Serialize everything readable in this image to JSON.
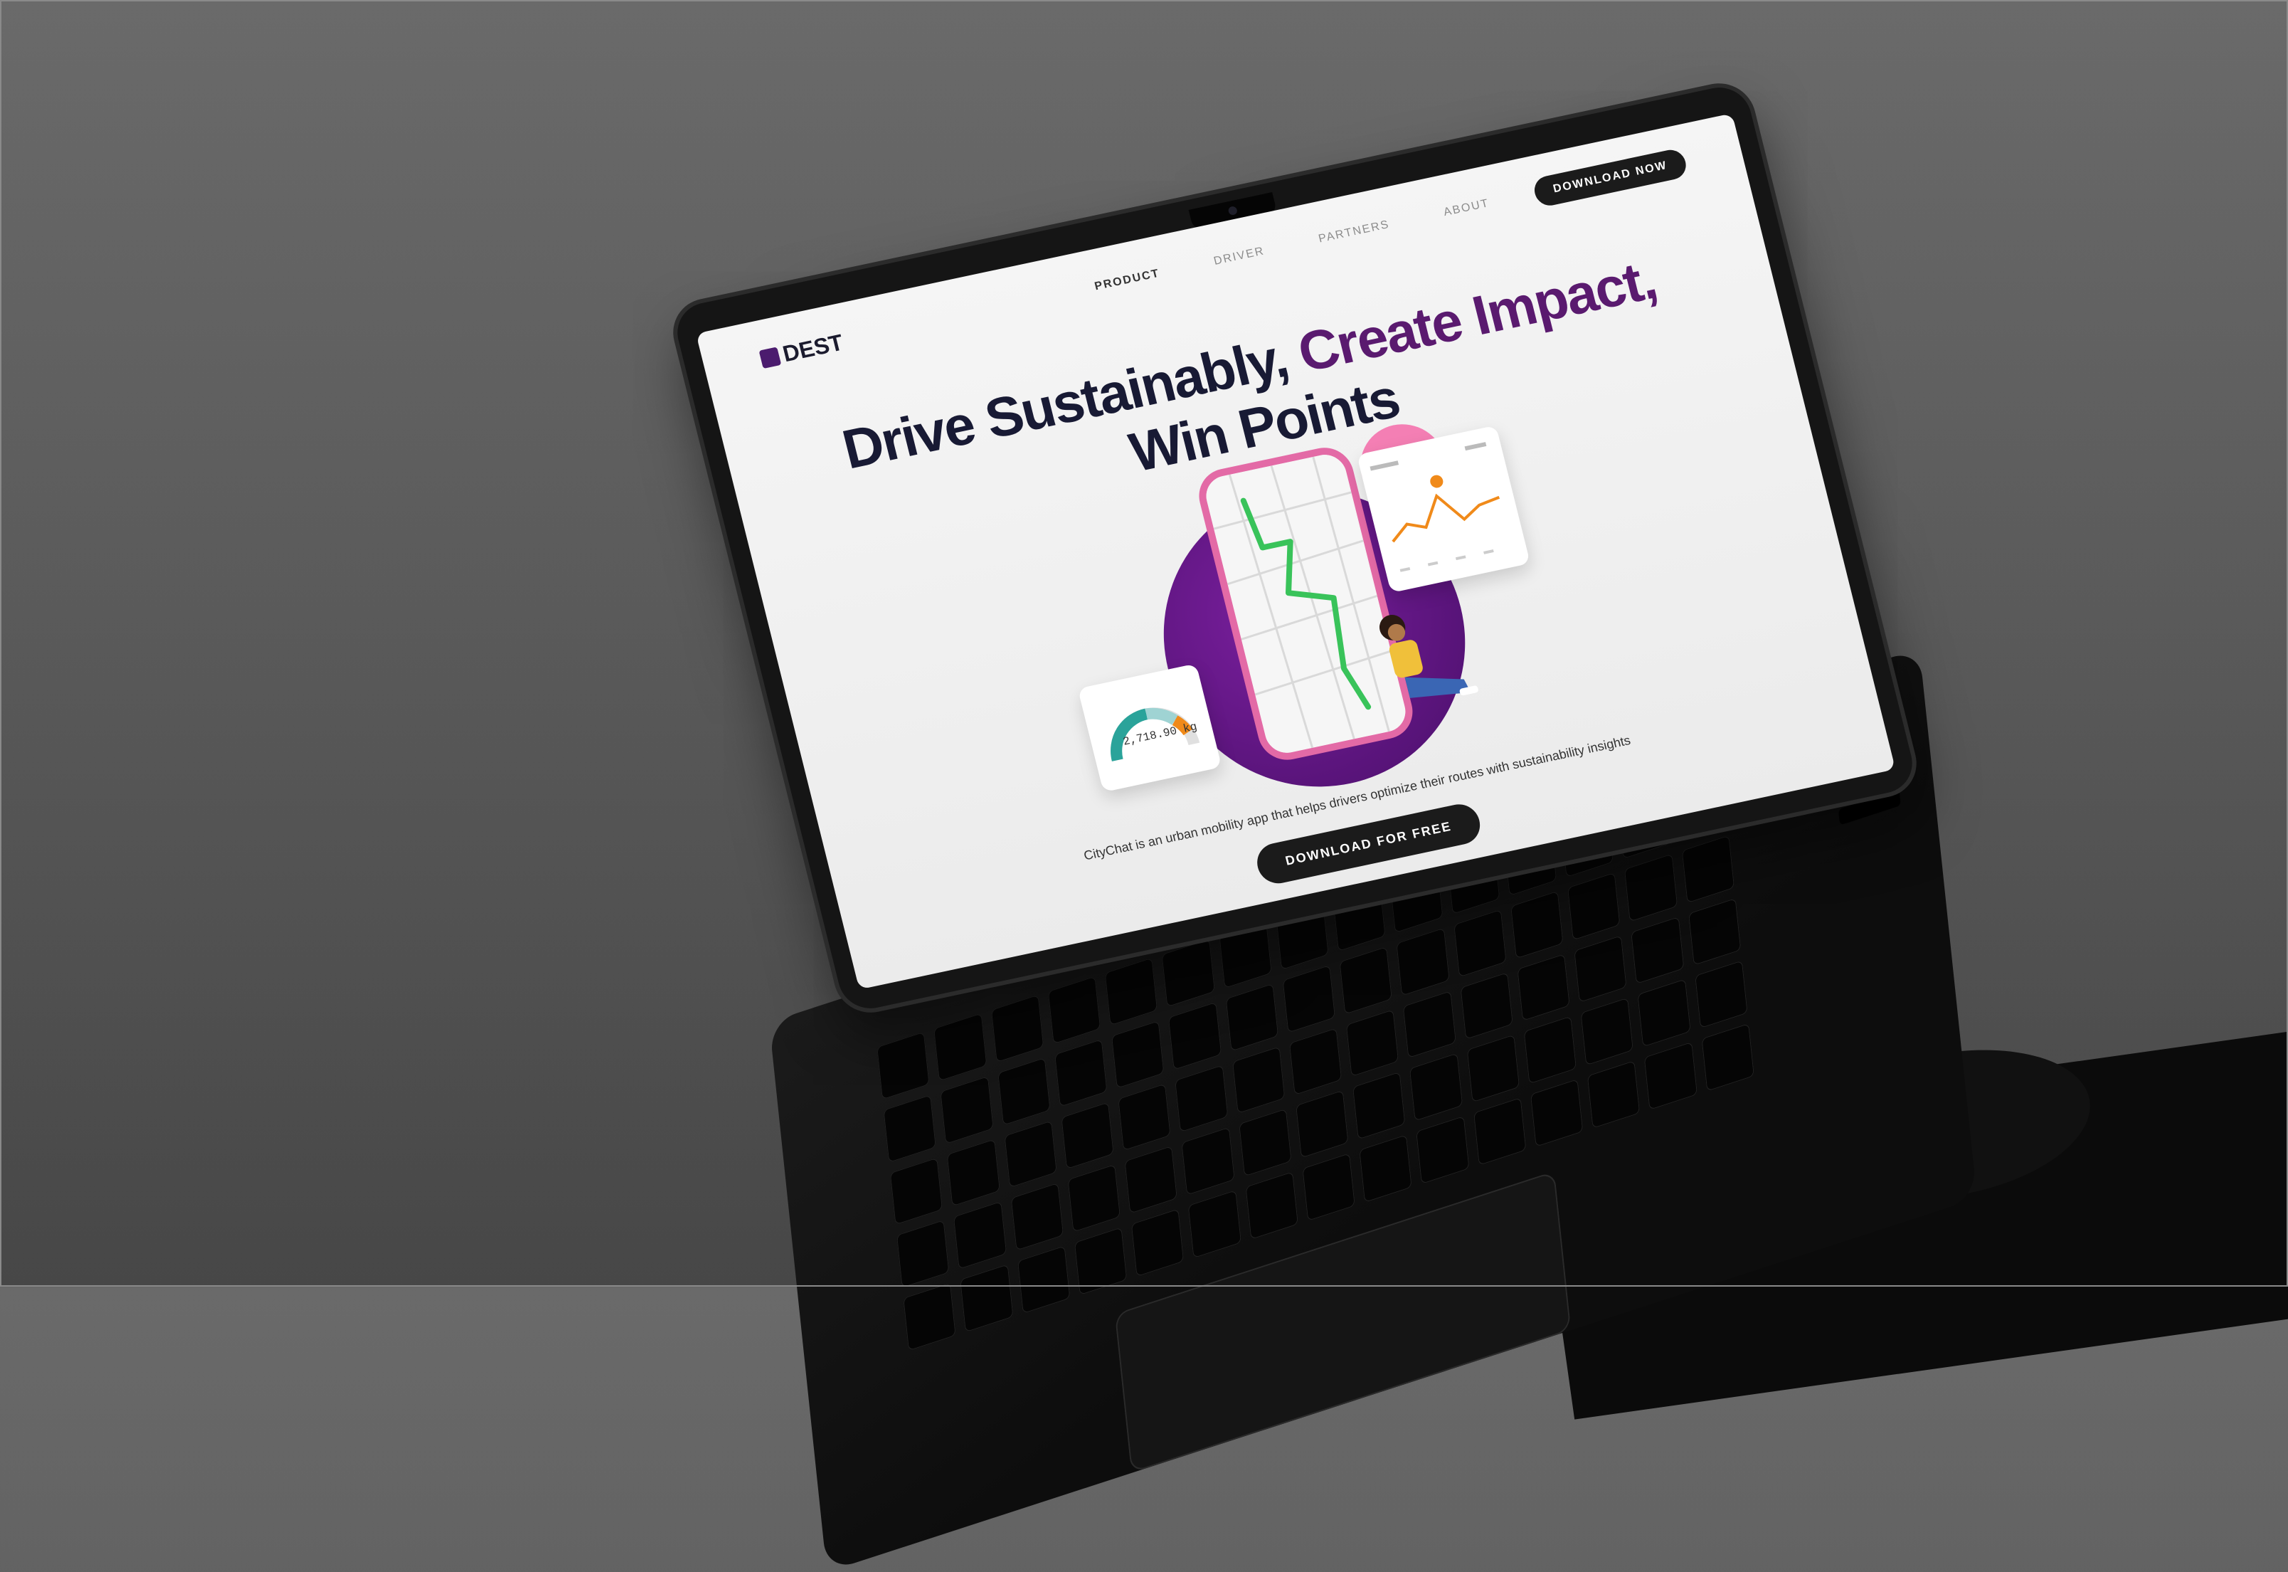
{
  "nav": {
    "logo_text": "DEST",
    "links": [
      "PRODUCT",
      "DRIVER",
      "PARTNERS",
      "ABOUT"
    ],
    "download_button": "DOWNLOAD NOW"
  },
  "hero": {
    "headline_part1": "Drive Sustainably,",
    "headline_part2": "Create Impact,",
    "headline_line2": "Win Points",
    "gauge_value": "2,718.90 kg",
    "description": "CityChat is an urban mobility app that helps drivers optimize their routes with sustainability insights",
    "cta_button": "DOWNLOAD FOR FREE"
  },
  "colors": {
    "brand_purple": "#5a1a6f",
    "pink": "#e36aa6",
    "route_green": "#39c35a",
    "chart_orange": "#f08a1a",
    "button_dark": "#1b1b1b"
  }
}
